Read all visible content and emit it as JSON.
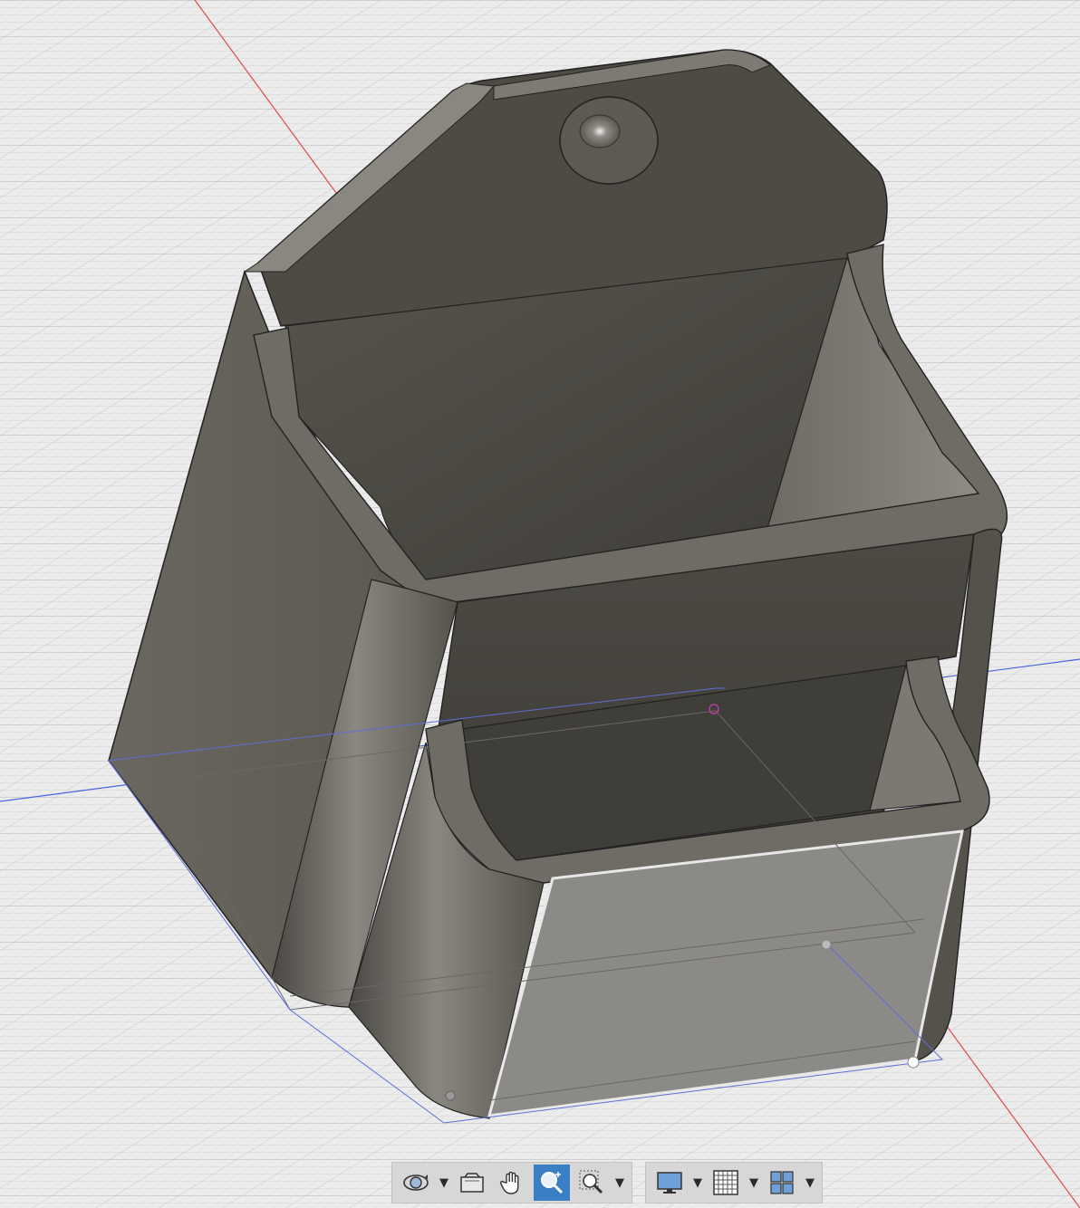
{
  "app": {
    "name": "3D CAD viewport"
  },
  "viewport": {
    "background": "#ececec",
    "grid_minor": "#d2d2d2",
    "grid_major": "#bdbdbd",
    "axis_x_color": "#e24848",
    "axis_y_color": "#4a64e0",
    "model_face_dark": "#4f4c46",
    "model_face_light": "#6a6760",
    "selected_face": "#8c8a86"
  },
  "toolbar": {
    "buttons": [
      {
        "id": "orbit",
        "icon": "orbit-icon",
        "has_dropdown": true,
        "active": false
      },
      {
        "id": "look-at",
        "icon": "look-at-icon",
        "has_dropdown": false,
        "active": false
      },
      {
        "id": "pan",
        "icon": "pan-hand-icon",
        "has_dropdown": false,
        "active": false
      },
      {
        "id": "zoom",
        "icon": "zoom-icon",
        "has_dropdown": false,
        "active": true
      },
      {
        "id": "fit",
        "icon": "zoom-window-icon",
        "has_dropdown": true,
        "active": false
      },
      {
        "id": "display-settings",
        "icon": "monitor-icon",
        "has_dropdown": true,
        "active": false
      },
      {
        "id": "grid-snaps",
        "icon": "grid-icon",
        "has_dropdown": true,
        "active": false
      },
      {
        "id": "viewports",
        "icon": "viewports-icon",
        "has_dropdown": true,
        "active": false
      }
    ],
    "accent": "#3a7fc4"
  }
}
